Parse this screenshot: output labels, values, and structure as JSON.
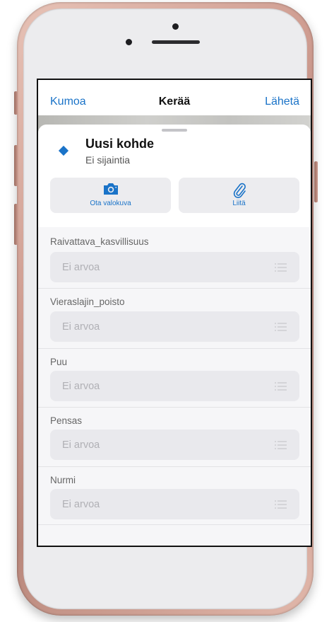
{
  "nav": {
    "cancel": "Kumoa",
    "title": "Kerää",
    "submit": "Lähetä"
  },
  "feature": {
    "title": "Uusi kohde",
    "subtitle": "Ei sijaintia"
  },
  "actions": {
    "photo": "Ota valokuva",
    "attach": "Liitä"
  },
  "fields": [
    {
      "label": "Raivattava_kasvillisuus",
      "value": "Ei arvoa"
    },
    {
      "label": "Vieraslajin_poisto",
      "value": "Ei arvoa"
    },
    {
      "label": "Puu",
      "value": "Ei arvoa"
    },
    {
      "label": "Pensas",
      "value": "Ei arvoa"
    },
    {
      "label": "Nurmi",
      "value": "Ei arvoa"
    }
  ],
  "icons": {
    "feature": "diamond-icon",
    "photo": "camera-icon",
    "attach": "paperclip-icon",
    "field": "list-icon"
  },
  "colors": {
    "accent": "#1a73c8",
    "frame": "#cf9d91"
  }
}
